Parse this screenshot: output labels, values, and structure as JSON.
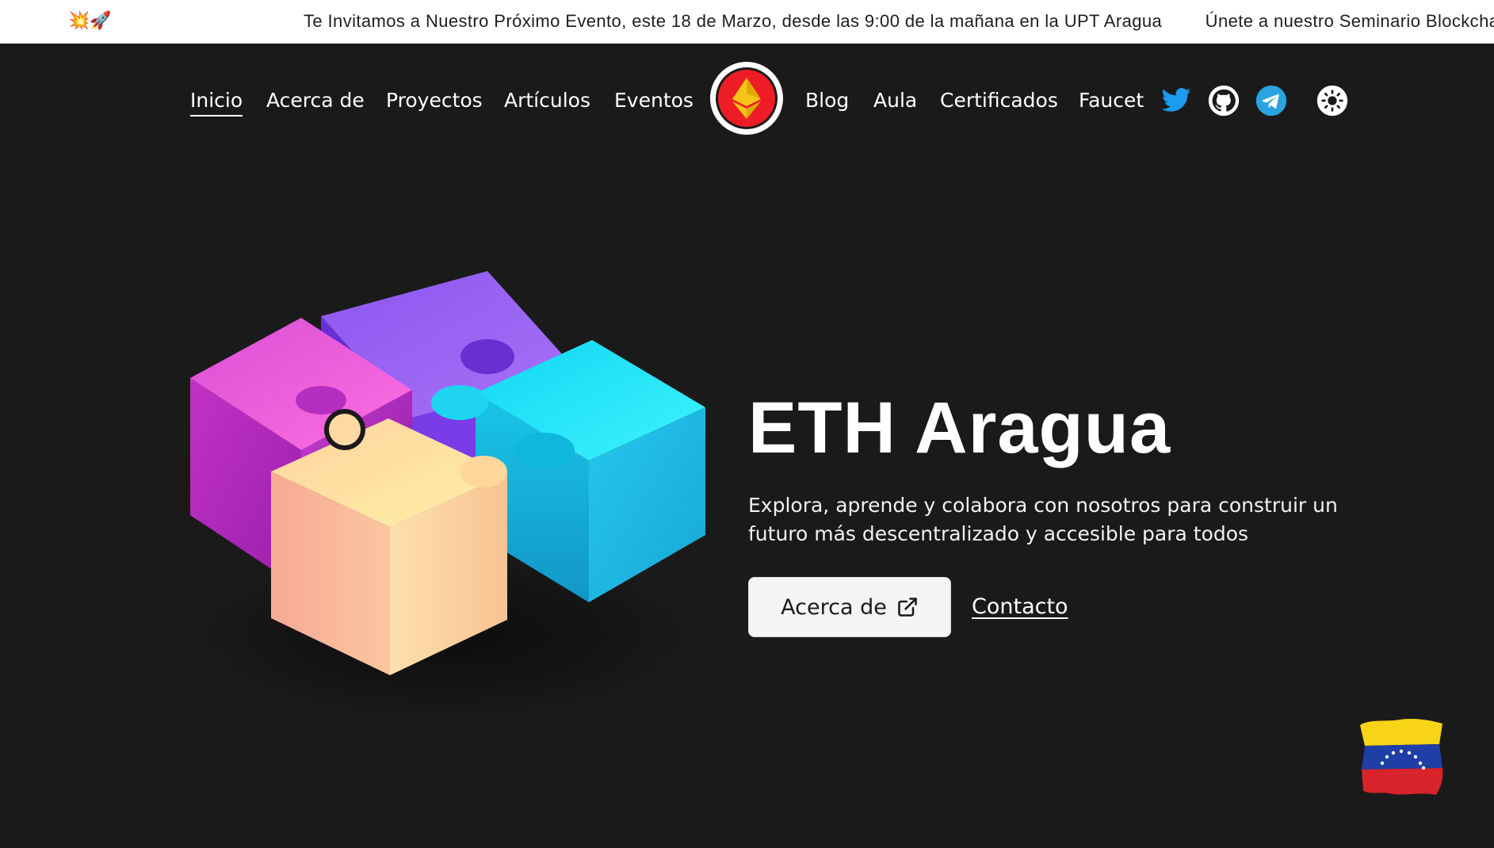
{
  "announcement": {
    "emoji": "💥🚀",
    "messages": [
      "Te Invitamos a Nuestro Próximo Evento, este 18 de Marzo, desde las 9:00 de la mañana en la UPT Aragua",
      "Únete a nuestro Seminario Blockchain"
    ]
  },
  "nav": {
    "left": [
      "Inicio",
      "Acerca de",
      "Proyectos",
      "Artículos",
      "Eventos"
    ],
    "right": [
      "Blog",
      "Aula",
      "Certificados",
      "Faucet"
    ],
    "active": "Inicio",
    "icons": [
      "twitter-icon",
      "github-icon",
      "telegram-icon",
      "theme-toggle-icon"
    ]
  },
  "hero": {
    "title": "ETH Aragua",
    "subtitle": "Explora, aprende y colabora con nosotros para construir un futuro más descentralizado y accesible para todos",
    "primary_button": "Acerca de",
    "secondary_link": "Contacto"
  },
  "colors": {
    "background": "#1b1a1b",
    "logo_red": "#ee1c25",
    "logo_gold": "#f5c518",
    "twitter_blue": "#1d9bf0",
    "telegram_blue": "#2aa3e0",
    "puzzle_magenta": "#d23fc9",
    "puzzle_purple": "#8a4df0",
    "puzzle_cyan": "#1ed4f0",
    "puzzle_peach": "#f7c8a0"
  }
}
